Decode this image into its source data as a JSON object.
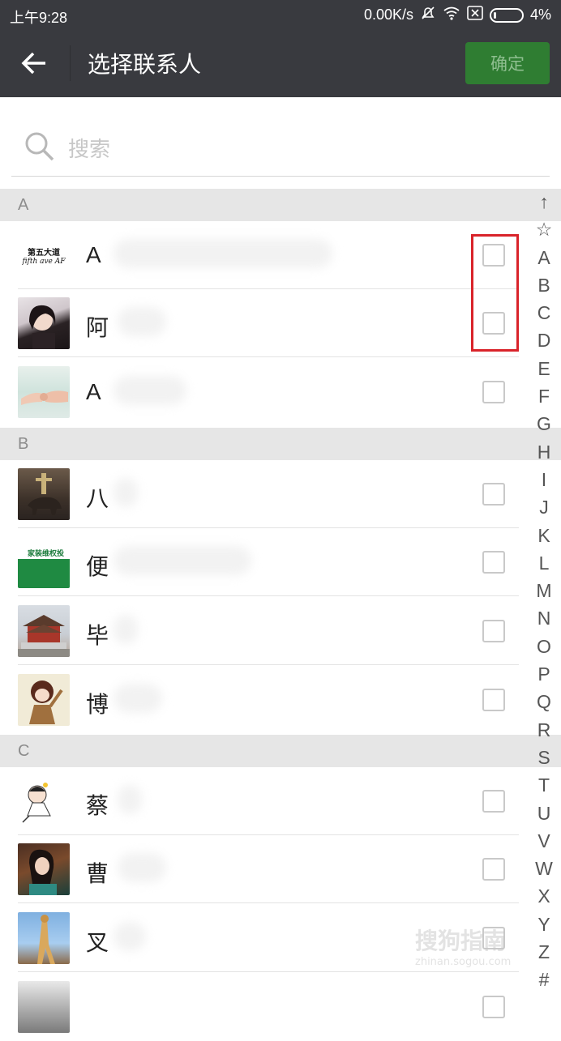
{
  "status": {
    "time": "上午9:28",
    "speed": "0.00K/s",
    "battery": "4%"
  },
  "header": {
    "title": "选择联系人",
    "confirm_label": "确定"
  },
  "search": {
    "placeholder": "搜索"
  },
  "sections": [
    {
      "letter": "A",
      "contacts": [
        {
          "name": "A",
          "checked": false
        },
        {
          "name": "阿",
          "checked": false
        },
        {
          "name": "A",
          "checked": false
        }
      ]
    },
    {
      "letter": "B",
      "contacts": [
        {
          "name": "八",
          "checked": false
        },
        {
          "name": "便",
          "checked": false
        },
        {
          "name": "毕",
          "checked": false
        },
        {
          "name": "博",
          "checked": false
        }
      ]
    },
    {
      "letter": "C",
      "contacts": [
        {
          "name": "蔡",
          "checked": false
        },
        {
          "name": "曹",
          "checked": false
        },
        {
          "name": "叉",
          "checked": false
        }
      ]
    }
  ],
  "avatar_text": {
    "a1_line1": "第五大道",
    "a1_line2": "fifth ave AF",
    "b2_text": "家装维权投"
  },
  "index_bar": [
    "↑",
    "☆",
    "A",
    "B",
    "C",
    "D",
    "E",
    "F",
    "G",
    "H",
    "I",
    "J",
    "K",
    "L",
    "M",
    "N",
    "O",
    "P",
    "Q",
    "R",
    "S",
    "T",
    "U",
    "V",
    "W",
    "X",
    "Y",
    "Z",
    "#"
  ],
  "watermark": {
    "text": "搜狗指南",
    "url": "zhinan.sogou.com"
  },
  "colors": {
    "header_bg": "#393a3f",
    "confirm_bg": "#2f7d32",
    "highlight": "#d9232a"
  }
}
